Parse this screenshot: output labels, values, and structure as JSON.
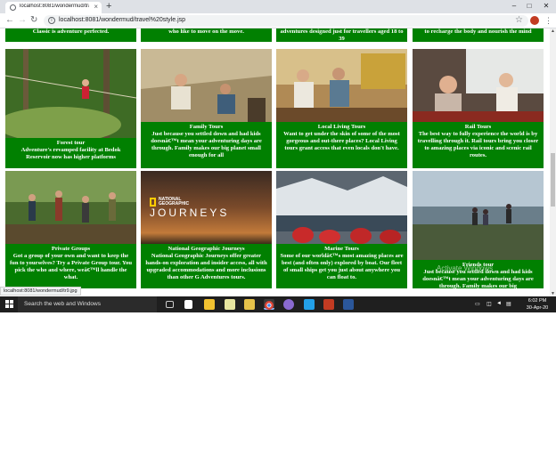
{
  "browser": {
    "tab_title": "localhost:8081/wondermud/trav",
    "tab_close": "×",
    "new_tab": "+",
    "url": "localhost:8081/wondermud/travel%20style.jsp",
    "info_icon": "i",
    "star": "☆",
    "menu": "⋮",
    "back": "←",
    "forward": "→",
    "reload": "↻",
    "minimize": "–",
    "maximize": "□",
    "close": "✕"
  },
  "top_row": [
    {
      "text": "Classic is adventure perfected."
    },
    {
      "text": "who like to move on the move."
    },
    {
      "text": "adventures designed just for travellers aged 18 to 39"
    },
    {
      "text": "to recharge the body and nourish the mind"
    }
  ],
  "cards": [
    {
      "title": "Forest tour",
      "desc": "Adventure's revamped facility at Bedok Reservoir now has higher platforms"
    },
    {
      "title": "Family Tours",
      "desc": "Just because you settled down and had kids doesnâ€™t mean your adventuring days are through. Family makes our big planet small enough for all"
    },
    {
      "title": "Local Living Tours",
      "desc": "Want to get under the skin of some of the most gorgeous and out-there places? Local Living tours grant access that even locals don't have."
    },
    {
      "title": "Rail Tours",
      "desc": "The best way to fully experience the world is by travelling through it. Rail tours bring you closer to amazing places via iconic and scenic rail routes."
    },
    {
      "title": "Private Groups",
      "desc": "Got a group of your own and want to keep the fun to yourselves? Try a Private Group tour. You pick the who and where, weâ€™ll handle the what."
    },
    {
      "title": "National Geographic Journeys",
      "desc": "National Geographic Journeys offer greater hands-on exploration and insider access, all with upgraded accommodations and more inclusions than other G Adventures tours."
    },
    {
      "title": "Marine Tours",
      "desc": "Some of our worldâ€™s most amazing places are best (and often only) explored by boat. Our fleet of small ships get you just about anywhere you can float to."
    },
    {
      "title": "Friends tour",
      "desc": "Just because you settled down and had kids doesnâ€™t mean your adventuring days are through. Family makes our big"
    }
  ],
  "natgeo": {
    "line1": "NATIONAL",
    "line2": "GEOGRAPHIC",
    "word": "JOURNEYS"
  },
  "status_url": "localhost:8081/wondermud/tr9.jpg",
  "watermark": "Activate Windows",
  "taskbar": {
    "search_placeholder": "Search the web and Windows",
    "time": "6:02 PM",
    "date": "30-Apr-20"
  },
  "icons": {
    "taskbar": [
      "task-view-icon",
      "store-icon",
      "file-explorer-icon",
      "notepad-icon",
      "files-icon",
      "chrome-icon",
      "media-icon",
      "vscode-icon",
      "app-icon",
      "word-icon"
    ],
    "tray": [
      "battery-icon",
      "network-icon",
      "volume-icon",
      "language-icon",
      "notification-icon"
    ]
  },
  "colors": {
    "card_green": "#018001",
    "taskbar": "#1f1f1f",
    "tab_strip": "#dee1e6"
  }
}
